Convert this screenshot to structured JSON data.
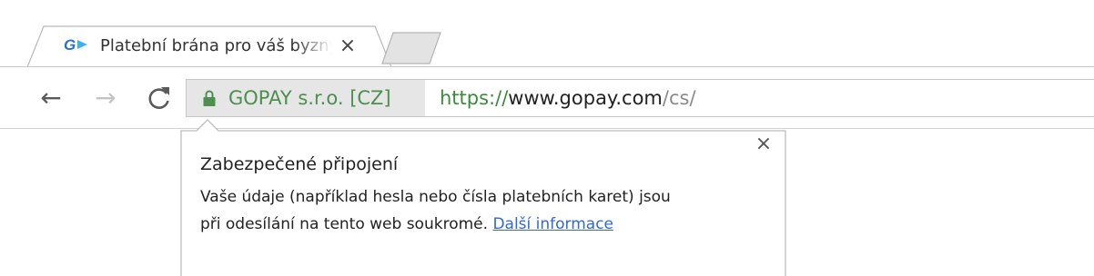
{
  "tab": {
    "title": "Platební brána pro váš byznys",
    "close_glyph": "×",
    "favicon": "gopay-logo-icon"
  },
  "toolbar": {
    "back_glyph": "←",
    "forward_glyph": "→",
    "reload_glyph": "C"
  },
  "omnibox": {
    "identity": "GOPAY s.r.o. [CZ]",
    "lock_icon": "lock-icon",
    "url_scheme": "https://",
    "url_host": "www.gopay.com",
    "url_path": "/cs/"
  },
  "security_popup": {
    "title": "Zabezpečené připojení",
    "body_line1": "Vaše údaje (například hesla nebo čísla platebních karet) jsou",
    "body_line2": "při odesílání na tento web soukromé. ",
    "link": "Další informace",
    "close_glyph": "×"
  },
  "colors": {
    "identity_green": "#4d8f4f",
    "link_blue": "#3367d6",
    "gopay_blue": "#2b6fd6"
  }
}
